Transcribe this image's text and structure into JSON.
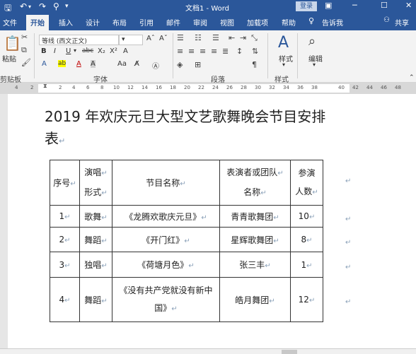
{
  "window": {
    "title": "文档1 - Word",
    "login_label": "登录"
  },
  "quick_access": {
    "save_icon": "save-icon",
    "undo_icon": "undo-icon",
    "redo_icon": "redo-icon"
  },
  "tabs": [
    "文件",
    "开始",
    "插入",
    "设计",
    "布局",
    "引用",
    "邮件",
    "审阅",
    "视图",
    "加载项",
    "帮助"
  ],
  "active_tab": "开始",
  "tell_me": "告诉我",
  "share": "共享",
  "ribbon": {
    "clipboard": {
      "paste_label": "粘贴",
      "group_label": "剪贴板"
    },
    "font": {
      "font_name": "等线 (西文正文)",
      "group_label": "字体"
    },
    "paragraph": {
      "group_label": "段落"
    },
    "styles": {
      "label": "样式",
      "group_label": "样式"
    },
    "editing": {
      "label": "编辑"
    }
  },
  "ruler": {
    "ticks": [
      "4",
      "2",
      "2",
      "4",
      "6",
      "8",
      "10",
      "12",
      "14",
      "16",
      "18",
      "20",
      "22",
      "24",
      "26",
      "28",
      "30",
      "32",
      "34",
      "36",
      "38",
      "40",
      "42",
      "44",
      "46",
      "48"
    ]
  },
  "document": {
    "title_line1": "2019 年欢庆元旦大型文艺歌舞晚会节目安排",
    "title_line2": "表",
    "table": {
      "headers": {
        "no": "序号",
        "form_l1": "演唱",
        "form_l2": "形式",
        "name": "节目名称",
        "performer_l1": "表演者或团队",
        "performer_l2": "名称",
        "count_l1": "参演",
        "count_l2": "人数"
      },
      "rows": [
        {
          "no": "1",
          "form": "歌舞",
          "name": "《龙腾欢歌庆元旦》",
          "performer": "青青歌舞团",
          "count": "10"
        },
        {
          "no": "2",
          "form": "舞蹈",
          "name": "《开门红》",
          "performer": "星辉歌舞团",
          "count": "8"
        },
        {
          "no": "3",
          "form": "独唱",
          "name": "《荷塘月色》",
          "performer": "张三丰",
          "count": "1"
        },
        {
          "no": "4",
          "form": "舞蹈",
          "name_l1": "《没有共产党就没有新中",
          "name_l2": "国》",
          "performer": "皓月舞团",
          "count": "12"
        }
      ]
    }
  },
  "colors": {
    "title_bar": "#2b579a",
    "ribbon_bg": "#f3f3f3",
    "page_bg": "#ffffff"
  }
}
